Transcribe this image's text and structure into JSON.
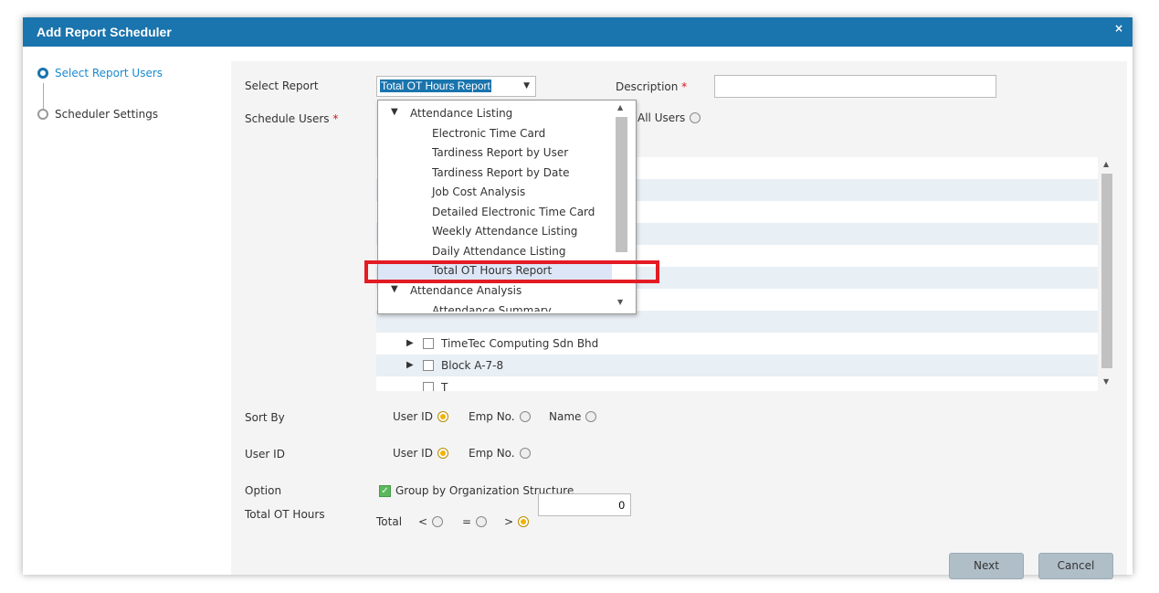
{
  "dialog": {
    "title": "Add Report Scheduler",
    "close_label": "×"
  },
  "steps": [
    {
      "label": "Select Report Users",
      "active": true
    },
    {
      "label": "Scheduler Settings",
      "active": false
    }
  ],
  "form": {
    "select_report_label": "Select Report",
    "select_report_value": "Total OT Hours Report",
    "description_label": "Description",
    "description_value": "",
    "required_mark": "*",
    "schedule_users_label": "Schedule Users",
    "all_users_label": "All Users",
    "sort_by_label": "Sort By",
    "sort_by_options": [
      "User ID",
      "Emp No.",
      "Name"
    ],
    "sort_by_selected": "User ID",
    "user_id_label": "User ID",
    "user_id_options": [
      "User ID",
      "Emp No."
    ],
    "user_id_selected": "User ID",
    "option_label": "Option",
    "group_by_label": "Group by Organization Structure",
    "group_by_checked": true,
    "total_ot_label": "Total OT Hours",
    "total_label": "Total",
    "compare_options": [
      "<",
      "=",
      ">"
    ],
    "compare_selected": ">",
    "total_value": "0"
  },
  "tree": {
    "rows": [
      {
        "label": "TimeTec Computing Sdn Bhd",
        "expandable": true
      },
      {
        "label": "Block A-7-8",
        "expandable": true
      },
      {
        "label": "T",
        "expandable": false
      }
    ]
  },
  "dropdown": {
    "items": [
      {
        "label": "Attendance Listing",
        "type": "group"
      },
      {
        "label": "Electronic Time Card",
        "type": "item"
      },
      {
        "label": "Tardiness Report by User",
        "type": "item"
      },
      {
        "label": "Tardiness Report by Date",
        "type": "item"
      },
      {
        "label": "Job Cost Analysis",
        "type": "item"
      },
      {
        "label": "Detailed Electronic Time Card",
        "type": "item"
      },
      {
        "label": "Weekly Attendance Listing",
        "type": "item"
      },
      {
        "label": "Daily Attendance Listing",
        "type": "item"
      },
      {
        "label": "Total OT Hours Report",
        "type": "item",
        "selected": true
      },
      {
        "label": "Attendance Analysis",
        "type": "group"
      },
      {
        "label": "Attendance Summary",
        "type": "item"
      }
    ]
  },
  "buttons": {
    "next": "Next",
    "cancel": "Cancel"
  },
  "colors": {
    "titlebar": "#1a74ad",
    "highlight": "#e31b23",
    "accent_radio": "#f0b400"
  }
}
